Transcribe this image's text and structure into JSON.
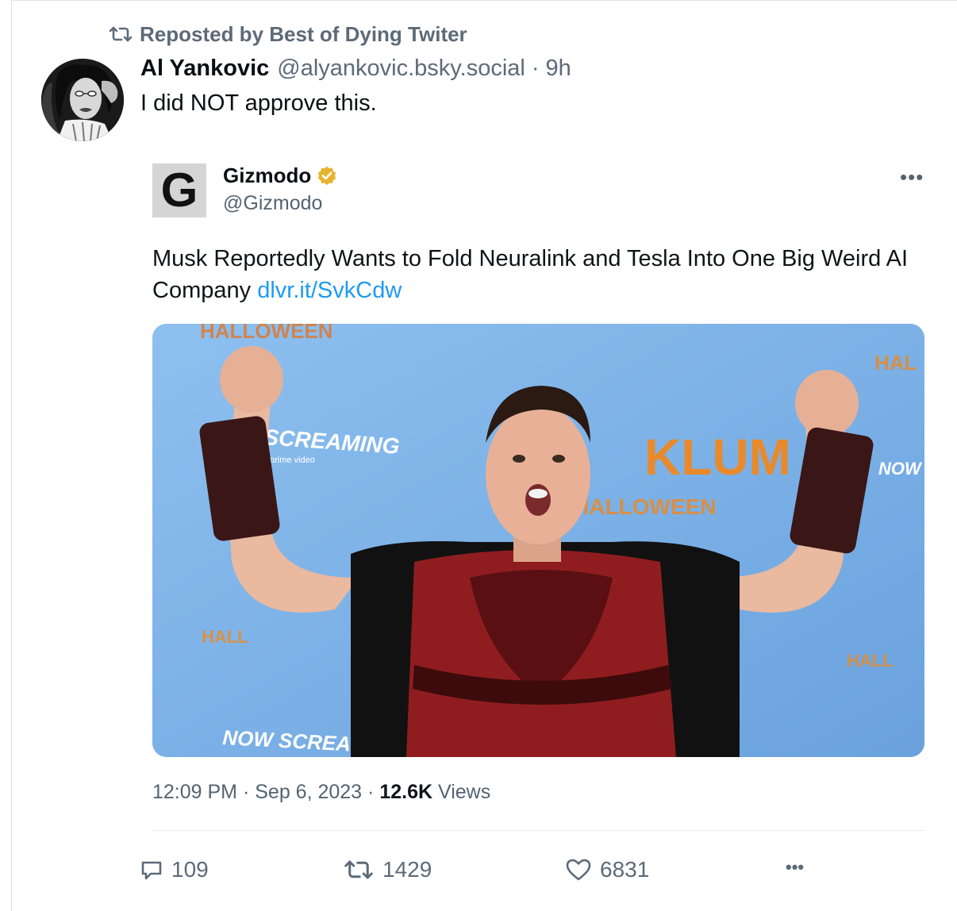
{
  "repost": {
    "label": "Reposted by Best of Dying Twiter",
    "icon": "repost-icon"
  },
  "post": {
    "author_name": "Al Yankovic",
    "author_handle": "@alyankovic.bsky.social",
    "separator": "·",
    "time": "9h",
    "text": "I did NOT approve this."
  },
  "embed": {
    "account_name": "Gizmodo",
    "account_handle": "@Gizmodo",
    "logo_letter": "G",
    "verified_icon": "verified-badge-icon",
    "more_label": "•••",
    "text": "Musk Reportedly Wants to Fold Neuralink and Tesla Into One Big Weird AI Company",
    "link": "dlvr.it/SvkCdw",
    "photo_texts": {
      "halloween_top": "HALLOWEEN",
      "screaming": "SCREAMING",
      "prime_video": "prime video",
      "klum": "KLUM",
      "halloween_mid": "HALLOWEEN",
      "now_right": "NOW",
      "hal_right": "HAL",
      "now_screaming": "NOW SCREAMING",
      "hall_right": "HALL",
      "hall_left": "HALL"
    },
    "time": "12:09 PM",
    "date": "Sep 6, 2023",
    "views_count": "12.6K",
    "views_label": "Views",
    "separator": "·"
  },
  "actions": {
    "replies": "109",
    "reposts": "1429",
    "likes": "6831",
    "more_label": "•••"
  },
  "colors": {
    "muted": "#5c6a78",
    "link": "#1d9bf0",
    "verified": "#e8b32a",
    "photo_background": "#7fb3e8",
    "armor": "#8f1d1f"
  }
}
